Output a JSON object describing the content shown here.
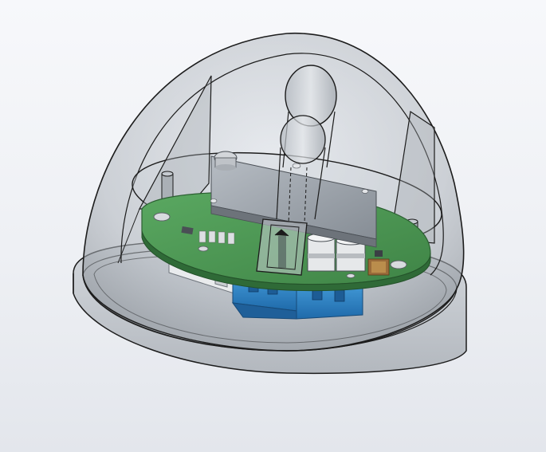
{
  "viewport": {
    "background": "cad-viewport-gradient",
    "model": "transparent-dome-enclosure-with-pcb"
  },
  "colors": {
    "dome_fill": "#b9bfc6",
    "dome_edge": "#1c1c1c",
    "pcb_green": "#4e9a55",
    "pcb_edge": "#2f6a37",
    "terminal_blue": "#2f86c9",
    "terminal_dark": "#1f5f99",
    "sensor_plate": "#9aa1a8",
    "bulb_glass": "#c7ccd2"
  },
  "icons": {
    "terminal_screw": "screw-icon",
    "standoff": "standoff-icon"
  }
}
